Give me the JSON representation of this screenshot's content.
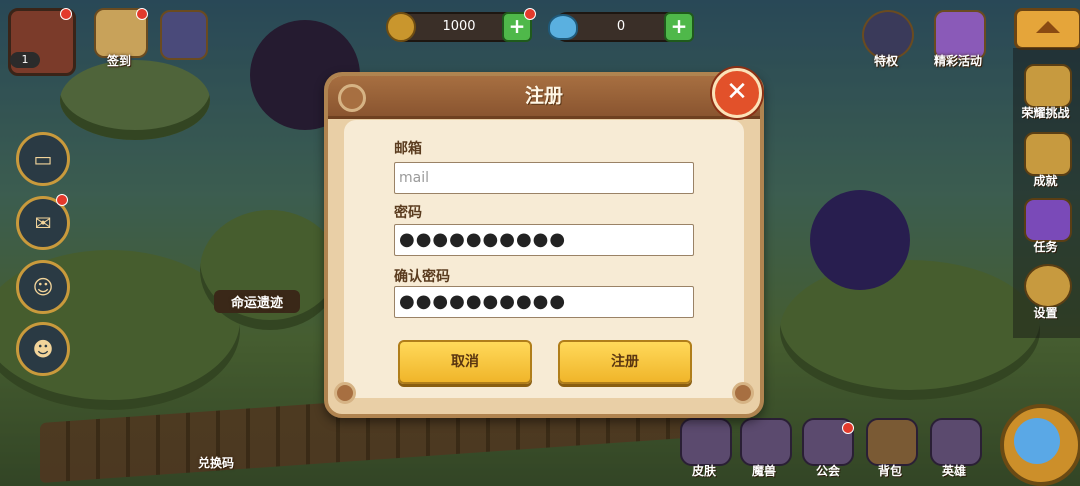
{
  "top_bar": {
    "avatar_level": "1",
    "checkin_label": "签到",
    "gold_amount": "1000",
    "gem_amount": "0",
    "privilege_label": "特权",
    "events_label": "精彩活动"
  },
  "right_menu": {
    "items": [
      {
        "label": "荣耀挑战",
        "icon": "trophy-icon"
      },
      {
        "label": "成就",
        "icon": "cup-icon"
      },
      {
        "label": "任务",
        "icon": "scroll-icon"
      },
      {
        "label": "设置",
        "icon": "gear-icon"
      }
    ]
  },
  "left_menu": {
    "icons": [
      "chat-icon",
      "mail-icon",
      "friends-icon",
      "emote-icon"
    ]
  },
  "map": {
    "fate_ruins_label": "命运遗迹",
    "redeem_code_label": "兑换码"
  },
  "bottom_bar": {
    "items": [
      {
        "label": "皮肤"
      },
      {
        "label": "魔兽"
      },
      {
        "label": "公会"
      },
      {
        "label": "背包"
      },
      {
        "label": "英雄"
      }
    ]
  },
  "dialog": {
    "title": "注册",
    "email_label": "邮箱",
    "email_placeholder": "mail",
    "password_label": "密码",
    "password_value": "●●●●●●●●●●",
    "confirm_label": "确认密码",
    "confirm_value": "●●●●●●●●●●",
    "cancel_label": "取消",
    "submit_label": "注册",
    "close_symbol": "✕"
  },
  "colors": {
    "title_bar": "#8a5530",
    "button_yellow": "#f0b52a",
    "close_red": "#e2512a"
  }
}
